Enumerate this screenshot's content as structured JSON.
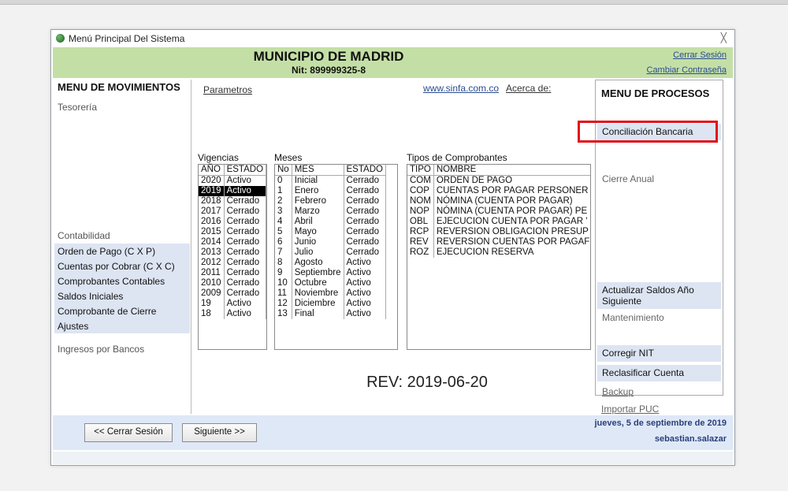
{
  "window": {
    "title": "Menú Principal Del Sistema",
    "close_glyph": "╳"
  },
  "header": {
    "municipio": "MUNICIPIO DE MADRID",
    "nit": "Nit: 899999325-8",
    "cerrar_sesion": "Cerrar Sesión",
    "cambiar_contrasena": "Cambiar Contraseña",
    "bg_color": "#c4dfa6"
  },
  "left_menu": {
    "title": "MENU DE MOVIMIENTOS",
    "tesoreria": "Tesorería",
    "contabilidad": "Contabilidad",
    "items": [
      "Orden de Pago (C X P)",
      "Cuentas por Cobrar (C X C)",
      "Comprobantes Contables",
      "Saldos Iniciales",
      "Comprobante de Cierre",
      "Ajustes"
    ],
    "ingresos": "Ingresos por Bancos"
  },
  "center": {
    "parametros": "Parametros",
    "website": "www.sinfa.com.co",
    "acerca": "Acerca de:",
    "vigencias": {
      "label": "Vigencias",
      "headers": [
        "AÑO",
        "ESTADO"
      ],
      "rows": [
        [
          "2020",
          "Activo"
        ],
        [
          "2019",
          "Activo"
        ],
        [
          "2018",
          "Cerrado"
        ],
        [
          "2017",
          "Cerrado"
        ],
        [
          "2016",
          "Cerrado"
        ],
        [
          "2015",
          "Cerrado"
        ],
        [
          "2014",
          "Cerrado"
        ],
        [
          "2013",
          "Cerrado"
        ],
        [
          "2012",
          "Cerrado"
        ],
        [
          "2011",
          "Cerrado"
        ],
        [
          "2010",
          "Cerrado"
        ],
        [
          "2009",
          "Cerrado"
        ],
        [
          "19",
          "Activo"
        ],
        [
          "18",
          "Activo"
        ]
      ],
      "selected_index": 1
    },
    "meses": {
      "label": "Meses",
      "headers": [
        "No",
        "MES",
        "ESTADO"
      ],
      "rows": [
        [
          "0",
          "Inicial",
          "Cerrado"
        ],
        [
          "1",
          "Enero",
          "Cerrado"
        ],
        [
          "2",
          "Febrero",
          "Cerrado"
        ],
        [
          "3",
          "Marzo",
          "Cerrado"
        ],
        [
          "4",
          "Abril",
          "Cerrado"
        ],
        [
          "5",
          "Mayo",
          "Cerrado"
        ],
        [
          "6",
          "Junio",
          "Cerrado"
        ],
        [
          "7",
          "Julio",
          "Cerrado"
        ],
        [
          "8",
          "Agosto",
          "Activo"
        ],
        [
          "9",
          "Septiembre",
          "Activo"
        ],
        [
          "10",
          "Octubre",
          "Activo"
        ],
        [
          "11",
          "Noviembre",
          "Activo"
        ],
        [
          "12",
          "Diciembre",
          "Activo"
        ],
        [
          "13",
          "Final",
          "Activo"
        ]
      ]
    },
    "tipos": {
      "label": "Tipos de Comprobantes",
      "headers": [
        "TIPO",
        "NOMBRE"
      ],
      "rows": [
        [
          "COM",
          "ORDEN DE PAGO"
        ],
        [
          "COP",
          "CUENTAS POR PAGAR PERSONER"
        ],
        [
          "NOM",
          "NÓMINA (CUENTA POR PAGAR)"
        ],
        [
          "NOP",
          "NÓMINA (CUENTA POR PAGAR) PE"
        ],
        [
          "OBL",
          "EJECUCION CUENTA POR PAGAR '"
        ],
        [
          "RCP",
          "REVERSION OBLIGACION PRESUP"
        ],
        [
          "REV",
          "REVERSION CUENTAS POR PAGAF"
        ],
        [
          "ROZ",
          "EJECUCION RESERVA"
        ]
      ]
    },
    "rev": "REV: 2019-06-20"
  },
  "right_menu": {
    "title": "MENU DE PROCESOS",
    "conciliacion": "Conciliación Bancaria",
    "cierre_anual": "Cierre Anual",
    "actualizar_1": "Actualizar Saldos Año",
    "actualizar_2": "Siguiente",
    "mantenimiento": "Mantenimiento",
    "corregir_nit": "Corregir NIT",
    "reclasificar": "Reclasificar Cuenta",
    "backup": "Backup",
    "importar_puc": "Importar PUC",
    "highlight_color": "#e0121a"
  },
  "footer": {
    "btn_cerrar": "<< Cerrar Sesión",
    "btn_siguiente": "Siguiente >>",
    "date": "jueves, 5 de septiembre de 2019",
    "user": "sebastian.salazar"
  }
}
